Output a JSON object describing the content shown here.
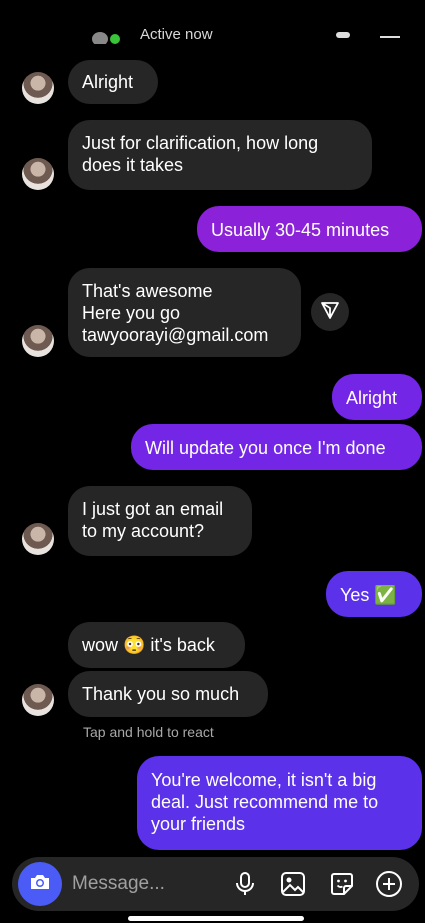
{
  "header": {
    "status": "Active now"
  },
  "messages": [
    {
      "from": "them",
      "lines": [
        "Alright"
      ]
    },
    {
      "from": "them",
      "lines": [
        "Just for clarification, how long",
        "does it takes"
      ]
    },
    {
      "from": "me",
      "lines": [
        "Usually 30-45 minutes"
      ]
    },
    {
      "from": "them",
      "lines": [
        "That's awesome",
        "Here you go",
        "tawyoorayi@gmail.com"
      ]
    },
    {
      "from": "me",
      "lines": [
        "Alright"
      ]
    },
    {
      "from": "me",
      "lines": [
        "Will update you once I'm done"
      ]
    },
    {
      "from": "them",
      "lines": [
        "I just got an email",
        "to my account?"
      ]
    },
    {
      "from": "me",
      "lines": [
        "Yes ✅"
      ]
    },
    {
      "from": "them",
      "lines": [
        "wow 😳 it's back"
      ]
    },
    {
      "from": "them",
      "lines": [
        "Thank you so much"
      ]
    },
    {
      "from": "me",
      "lines": [
        "You're welcome, it isn't a big",
        "deal. Just recommend me to",
        "your friends"
      ]
    }
  ],
  "hint": "Tap and hold to react",
  "composer": {
    "placeholder": "Message..."
  },
  "colors": {
    "outgoing_top": "#8b21d8",
    "outgoing_bottom": "#5b31ea",
    "incoming": "#262626",
    "camera_button": "#4a5cf5"
  },
  "icons": [
    "camera-icon",
    "microphone-icon",
    "gallery-icon",
    "sticker-icon",
    "plus-circle-icon",
    "share-icon"
  ]
}
